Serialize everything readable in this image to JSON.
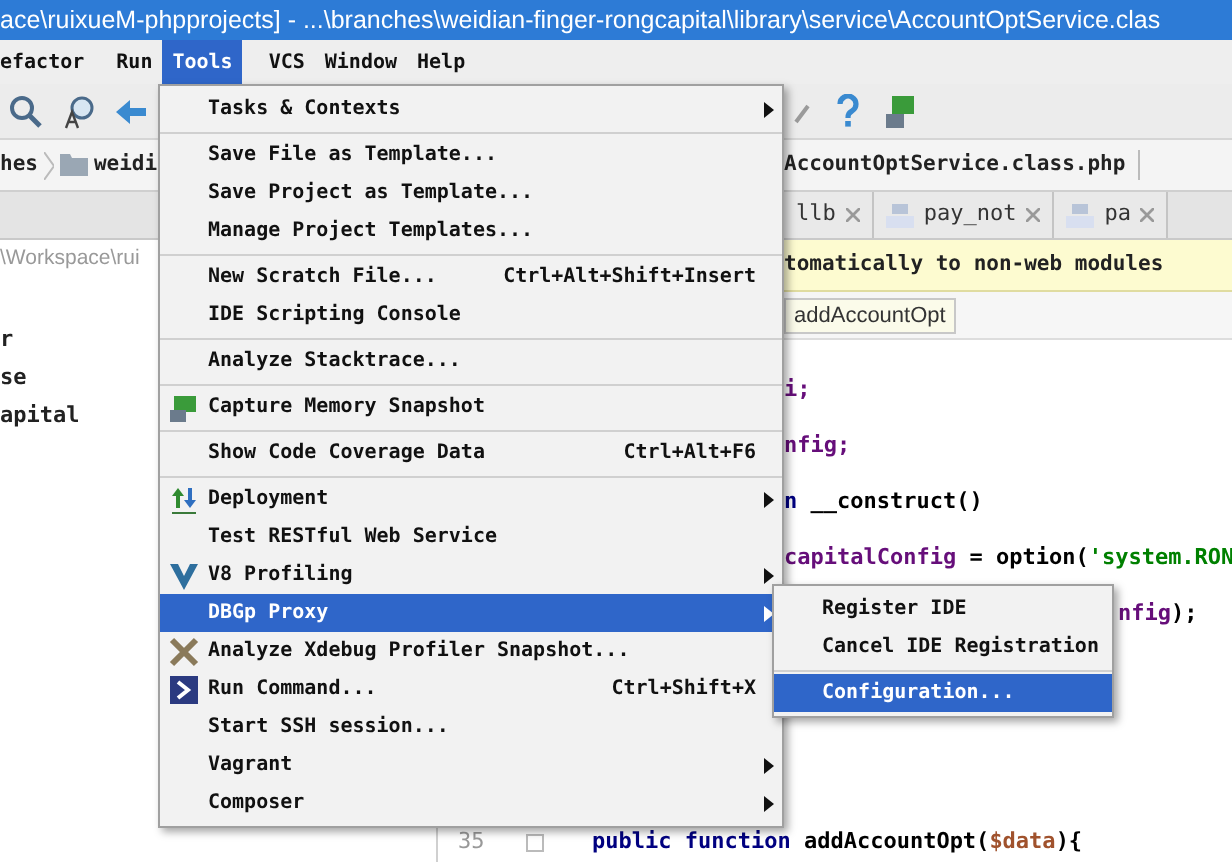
{
  "window": {
    "title": "ace\\ruixueM-phpprojects] - ...\\branches\\weidian-finger-rongcapital\\library\\service\\AccountOptService.clas"
  },
  "menubar": [
    {
      "label": "efactor",
      "selected": false
    },
    {
      "label": "Run",
      "selected": false
    },
    {
      "label": "Tools",
      "selected": true
    },
    {
      "label": "VCS",
      "selected": false
    },
    {
      "label": "Window",
      "selected": false
    },
    {
      "label": "Help",
      "selected": false
    }
  ],
  "navbar": {
    "left": [
      "hes",
      "weidi"
    ],
    "right": [
      "AccountOptService.class.php"
    ]
  },
  "tabs": [
    {
      "label": "llb"
    },
    {
      "label": "pay_not"
    },
    {
      "label": "pa"
    }
  ],
  "project": {
    "path": "\\Workspace\\rui",
    "items": [
      "r",
      "se",
      "apital"
    ]
  },
  "notice": "tomatically to non-web modules",
  "breadcrumb": "addAccountOpt",
  "code": [
    {
      "kind": "fragment",
      "tokens": [
        {
          "kind": "field",
          "text": "i;"
        }
      ]
    },
    {
      "kind": "fragment",
      "tokens": [
        {
          "kind": "field",
          "text": "nfig;"
        }
      ]
    },
    {
      "kind": "fragment",
      "tokens": [
        {
          "kind": "keyword",
          "text": "n"
        },
        {
          "kind": "plain",
          "text": " __construct()"
        }
      ]
    },
    {
      "kind": "fragment",
      "tokens": [
        {
          "kind": "field",
          "text": "capitalConfig"
        },
        {
          "kind": "plain",
          "text": " = option("
        },
        {
          "kind": "string",
          "text": "'system.RON"
        }
      ]
    },
    {
      "kind": "fragment",
      "tokens": [
        {
          "kind": "field",
          "text": "nfig"
        },
        {
          "kind": "plain",
          "text": ");"
        }
      ]
    },
    {
      "kind": "line",
      "number": "35",
      "tokens": [
        {
          "kind": "keyword",
          "text": "public function"
        },
        {
          "kind": "plain",
          "text": " addAccountOpt("
        },
        {
          "kind": "variable",
          "text": "$data"
        },
        {
          "kind": "plain",
          "text": "){"
        }
      ]
    }
  ],
  "menu": {
    "items": [
      {
        "kind": "item",
        "label": "Tasks & Contexts",
        "submenu": true,
        "selected": false
      },
      {
        "kind": "separator"
      },
      {
        "kind": "item",
        "label": "Save File as Template...",
        "selected": false
      },
      {
        "kind": "item",
        "label": "Save Project as Template...",
        "selected": false
      },
      {
        "kind": "item",
        "label": "Manage Project Templates...",
        "selected": false
      },
      {
        "kind": "separator"
      },
      {
        "kind": "item",
        "label": "New Scratch File...",
        "shortcut": "Ctrl+Alt+Shift+Insert",
        "selected": false
      },
      {
        "kind": "item",
        "label": "IDE Scripting Console",
        "selected": false
      },
      {
        "kind": "separator"
      },
      {
        "kind": "item",
        "label": "Analyze Stacktrace...",
        "selected": false
      },
      {
        "kind": "separator"
      },
      {
        "kind": "item",
        "label": "Capture Memory Snapshot",
        "selected": false
      },
      {
        "kind": "separator"
      },
      {
        "kind": "item",
        "label": "Show Code Coverage Data",
        "shortcut": "Ctrl+Alt+F6",
        "selected": false
      },
      {
        "kind": "separator"
      },
      {
        "kind": "item",
        "label": "Deployment",
        "submenu": true,
        "selected": false
      },
      {
        "kind": "item",
        "label": "Test RESTful Web Service",
        "selected": false
      },
      {
        "kind": "item",
        "label": "V8 Profiling",
        "submenu": true,
        "selected": false
      },
      {
        "kind": "item",
        "label": "DBGp Proxy",
        "submenu": true,
        "selected": true
      },
      {
        "kind": "item",
        "label": "Analyze Xdebug Profiler Snapshot...",
        "selected": false
      },
      {
        "kind": "item",
        "label": "Run Command...",
        "shortcut": "Ctrl+Shift+X",
        "selected": false
      },
      {
        "kind": "item",
        "label": "Start SSH session...",
        "selected": false
      },
      {
        "kind": "item",
        "label": "Vagrant",
        "submenu": true,
        "selected": false
      },
      {
        "kind": "item",
        "label": "Composer",
        "submenu": true,
        "selected": false
      }
    ]
  },
  "submenu": {
    "items": [
      {
        "kind": "item",
        "label": "Register IDE",
        "selected": false
      },
      {
        "kind": "item",
        "label": "Cancel IDE Registration",
        "selected": false
      },
      {
        "kind": "separator"
      },
      {
        "kind": "item",
        "label": "Configuration...",
        "selected": true
      }
    ]
  }
}
